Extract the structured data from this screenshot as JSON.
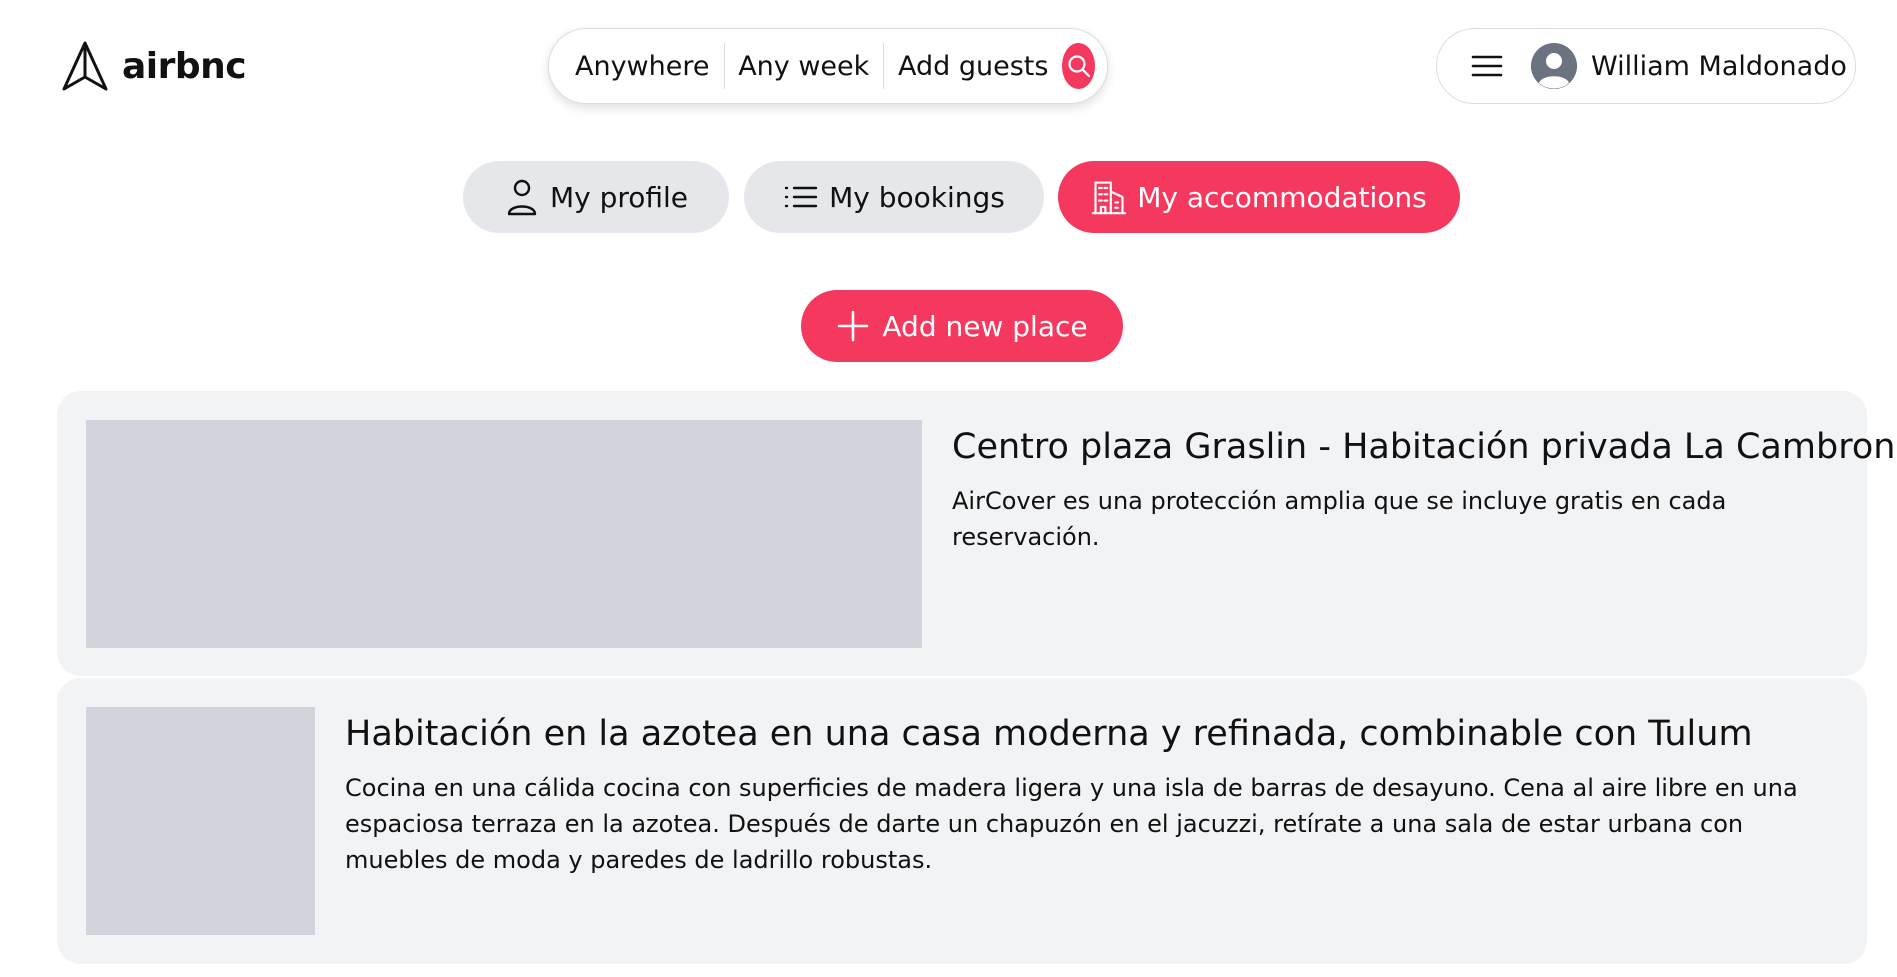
{
  "header": {
    "logo_text": "airbnc",
    "search": {
      "where": "Anywhere",
      "when": "Any week",
      "guests": "Add guests"
    },
    "user": {
      "name": "William Maldonado"
    }
  },
  "tabs": [
    {
      "label": "My profile",
      "icon": "user-icon",
      "active": false
    },
    {
      "label": "My bookings",
      "icon": "list-icon",
      "active": false
    },
    {
      "label": "My accommodations",
      "icon": "building-icon",
      "active": true
    }
  ],
  "actions": {
    "add_place_label": "Add new place"
  },
  "listings": [
    {
      "title": "Centro plaza Graslin - Habitación privada La Cambronne",
      "description": "AirCover es una protección amplia que se incluye gratis en cada reservación."
    },
    {
      "title": "Habitación en la azotea en una casa moderna y refinada, combinable con Tulum",
      "description": "Cocina en una cálida cocina con superficies de madera ligera y una isla de barras de desayuno. Cena al aire libre en una espaciosa terraza en la azotea. Después de darte un chapuzón en el jacuzzi, retírate a una sala de estar urbana con muebles de moda y paredes de ladrillo robustas."
    }
  ],
  "colors": {
    "accent": "#f5385d",
    "tab_inactive": "#e5e7eb",
    "card_bg": "#f2f3f5",
    "thumb_placeholder": "#d1d5db"
  }
}
